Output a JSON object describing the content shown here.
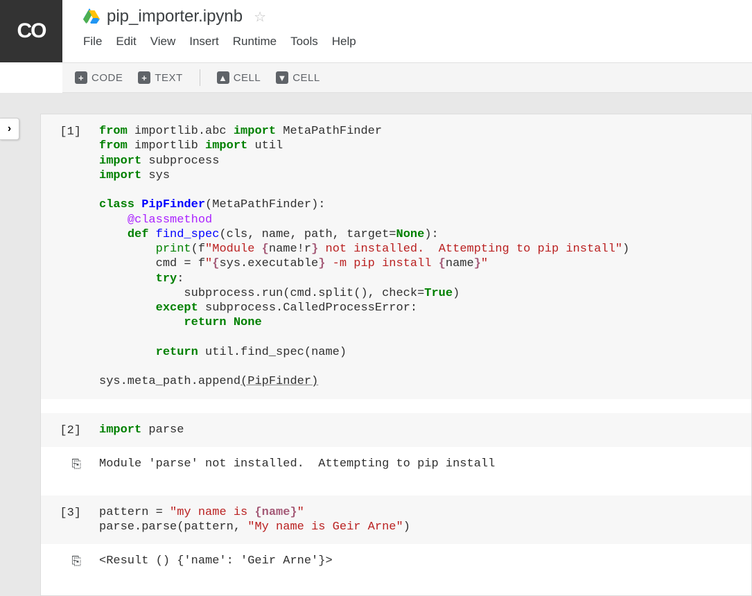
{
  "header": {
    "logo": "CO",
    "filename": "pip_importer.ipynb"
  },
  "menu": {
    "file": "File",
    "edit": "Edit",
    "view": "View",
    "insert": "Insert",
    "runtime": "Runtime",
    "tools": "Tools",
    "help": "Help"
  },
  "toolbar": {
    "code": "CODE",
    "text": "TEXT",
    "cell_up": "CELL",
    "cell_down": "CELL"
  },
  "cells": [
    {
      "prompt": "[1]",
      "code": {
        "l1": {
          "a": "from",
          "b": " importlib.abc ",
          "c": "import",
          "d": " MetaPathFinder"
        },
        "l2": {
          "a": "from",
          "b": " importlib ",
          "c": "import",
          "d": " util"
        },
        "l3": {
          "a": "import",
          "b": " subprocess"
        },
        "l4": {
          "a": "import",
          "b": " sys"
        },
        "l5": "",
        "l6": {
          "a": "class",
          "b": " ",
          "c": "PipFinder",
          "d": "(MetaPathFinder):"
        },
        "l7": {
          "a": "    ",
          "b": "@classmethod"
        },
        "l8": {
          "a": "    ",
          "b": "def",
          "c": " ",
          "d": "find_spec",
          "e": "(cls, name, path, target=",
          "f": "None",
          "g": "):"
        },
        "l9": {
          "a": "        ",
          "b": "print",
          "c": "(f",
          "d": "\"Module ",
          "e": "{",
          "f": "name!r",
          "g": "}",
          "h": " not installed.  Attempting to pip install\"",
          "i": ")"
        },
        "l10": {
          "a": "        cmd = f",
          "b": "\"",
          "c": "{",
          "d": "sys.executable",
          "e": "}",
          "f": " -m pip install ",
          "g": "{",
          "h": "name",
          "i": "}",
          "j": "\""
        },
        "l11": {
          "a": "        ",
          "b": "try",
          "c": ":"
        },
        "l12": {
          "a": "            subprocess.run(cmd.split(), check=",
          "b": "True",
          "c": ")"
        },
        "l13": {
          "a": "        ",
          "b": "except",
          "c": " subprocess.CalledProcessError:"
        },
        "l14": {
          "a": "            ",
          "b": "return",
          "c": " ",
          "d": "None"
        },
        "l15": "",
        "l16": {
          "a": "        ",
          "b": "return",
          "c": " util.find_spec(name)"
        },
        "l17": "",
        "l18": {
          "a": "sys.meta_path.append",
          "b": "(PipFinder)"
        }
      }
    },
    {
      "prompt": "[2]",
      "code": {
        "a": "import",
        "b": " parse"
      },
      "output": "Module 'parse' not installed.  Attempting to pip install"
    },
    {
      "prompt": "[3]",
      "code": {
        "l1": {
          "a": "pattern = ",
          "b": "\"my name is ",
          "c": "{name}",
          "d": "\""
        },
        "l2": {
          "a": "parse.parse(pattern, ",
          "b": "\"My name is Geir Arne\"",
          "c": ")"
        }
      },
      "output": "<Result () {'name': 'Geir Arne'}>"
    }
  ]
}
